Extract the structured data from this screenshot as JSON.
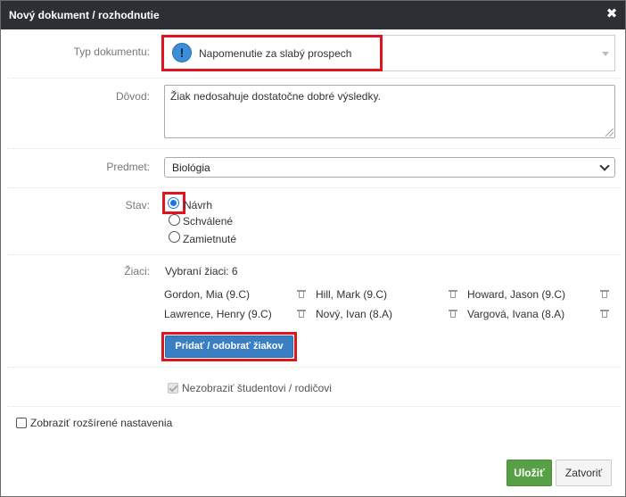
{
  "dialog": {
    "title": "Nový dokument / rozhodnutie",
    "close_icon": "close-icon"
  },
  "form": {
    "type_label": "Typ dokumentu:",
    "type_value": "Napomenutie za slabý prospech",
    "type_icon": "exclamation-icon",
    "reason_label": "Dôvod:",
    "reason_value": "Žiak nedosahuje dostatočne dobré výsledky.",
    "subject_label": "Predmet:",
    "subject_value": "Biológia",
    "status_label": "Stav:",
    "status_options": [
      {
        "label": "Návrh",
        "selected": true
      },
      {
        "label": "Schválené",
        "selected": false
      },
      {
        "label": "Zamietnuté",
        "selected": false
      }
    ],
    "students_label": "Žiaci:",
    "students_count_text": "Vybraní žiaci: 6",
    "students": [
      "Gordon, Mia (9.C)",
      "Hill, Mark (9.C)",
      "Howard, Jason (9.C)",
      "Lawrence, Henry (9.C)",
      "Nový, Ivan (8.A)",
      "Vargová, Ivana (8.A)"
    ],
    "add_remove_students_label": "Pridať / odobrať žiakov",
    "hide_from_student_label": "Nezobraziť študentovi / rodičovi",
    "hide_from_student_checked": true,
    "hide_from_student_disabled": true,
    "advanced_settings_label": "Zobraziť rozšírené nastavenia",
    "advanced_settings_checked": false
  },
  "footer": {
    "save_label": "Uložiť",
    "close_label": "Zatvoriť"
  },
  "colors": {
    "titlebar": "#2c3034",
    "highlight": "#e0141e",
    "primary_button": "#3a7fc4",
    "save_button": "#58a046"
  }
}
